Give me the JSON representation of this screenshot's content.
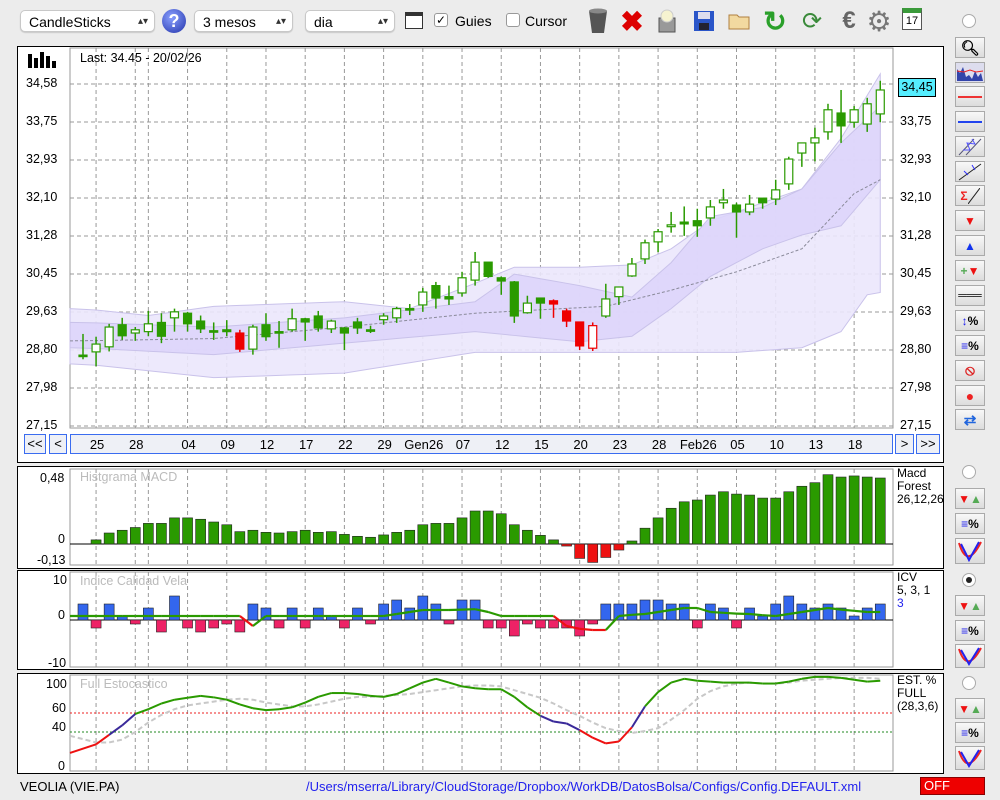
{
  "toolbar": {
    "chart_type": "CandleSticks",
    "period": "3 mesos",
    "interval": "dia",
    "guides_label": "Guies",
    "guides_checked": true,
    "cursor_label": "Cursor",
    "cursor_checked": false,
    "icons": [
      "trash-icon",
      "delete-icon",
      "lamp-icon",
      "save-icon",
      "open-folder-icon",
      "refresh-icon",
      "sync-icon",
      "euro-icon",
      "gear-icon",
      "calendar-icon"
    ],
    "calendar_day": "17"
  },
  "main": {
    "last_label": "Last: 34.45 - 20/02/26",
    "current_price": "34,45",
    "price_ticks": [
      "34,58",
      "33,75",
      "32,93",
      "32,10",
      "31,28",
      "30,45",
      "29,63",
      "28,80",
      "27,98",
      "27,15"
    ],
    "nav": {
      "first": "<<",
      "prev": "<",
      "next": ">",
      "last": ">>"
    },
    "date_labels": [
      {
        "label": "25",
        "i": 1
      },
      {
        "label": "28",
        "i": 4
      },
      {
        "label": "04",
        "i": 8
      },
      {
        "label": "09",
        "i": 11
      },
      {
        "label": "12",
        "i": 14
      },
      {
        "label": "17",
        "i": 17
      },
      {
        "label": "22",
        "i": 20
      },
      {
        "label": "29",
        "i": 23
      },
      {
        "label": "Gen26",
        "i": 26
      },
      {
        "label": "07",
        "i": 29
      },
      {
        "label": "12",
        "i": 32
      },
      {
        "label": "15",
        "i": 35
      },
      {
        "label": "20",
        "i": 38
      },
      {
        "label": "23",
        "i": 41
      },
      {
        "label": "28",
        "i": 44
      },
      {
        "label": "Feb26",
        "i": 47
      },
      {
        "label": "05",
        "i": 50
      },
      {
        "label": "10",
        "i": 53
      },
      {
        "label": "13",
        "i": 56
      },
      {
        "label": "18",
        "i": 59
      }
    ]
  },
  "macd_panel": {
    "title": "Histgrama MACD",
    "legend": [
      "Macd",
      "Forest",
      "26,12,26"
    ],
    "ticks": [
      "0,48",
      "0",
      "-0,13"
    ]
  },
  "icv_panel": {
    "title": "Indice Calidad Vela",
    "legend": [
      "ICV",
      "5, 3, 1"
    ],
    "legend_value": "3",
    "ticks": [
      "10",
      "0",
      "-10"
    ]
  },
  "stoch_panel": {
    "title": "Full Estocastico",
    "legend": [
      "EST. %",
      "FULL",
      "(28,3,6)"
    ],
    "ticks": [
      "100",
      "60",
      "40",
      "0"
    ]
  },
  "footer": {
    "symbol": "VEOLIA (VIE.PA)",
    "config_path": "/Users/mserra/Library/CloudStorage/Dropbox/WorkDB/DatosBolsa/Configs/Config.DEFAULT.xml",
    "status": "OFF"
  },
  "colors": {
    "up": "#2a9a00",
    "down_red": "#ee0000",
    "band_outer": "#ebe7fc",
    "band_inner": "#ddd5fb",
    "macd_pos": "#2a9a00",
    "macd_neg": "#ee1111",
    "icv_pos": "#3366ee",
    "icv_neg": "#ee2266",
    "stoch_hi": "#2a9a00",
    "stoch_mid": "#3a2a9a",
    "stoch_lo": "#ee1111",
    "accent_cyan": "#55eeff",
    "status_red": "#ee0000",
    "path_blue": "#2222ee"
  },
  "chart_data": {
    "type": "candlestick",
    "y_range": [
      27.15,
      34.58
    ],
    "candles_ohlc": [
      [
        28.69,
        29.15,
        28.6,
        28.69
      ],
      [
        28.76,
        29.09,
        28.45,
        28.93
      ],
      [
        28.87,
        29.37,
        28.77,
        29.3
      ],
      [
        29.35,
        29.5,
        29.02,
        29.11
      ],
      [
        29.17,
        29.3,
        29.0,
        29.24
      ],
      [
        29.2,
        29.65,
        29.1,
        29.37
      ],
      [
        29.4,
        29.6,
        28.95,
        29.1
      ],
      [
        29.5,
        29.7,
        29.2,
        29.63
      ],
      [
        29.6,
        29.63,
        29.2,
        29.37
      ],
      [
        29.43,
        29.55,
        29.17,
        29.26
      ],
      [
        29.22,
        29.4,
        29.02,
        29.22
      ],
      [
        29.24,
        29.45,
        29.1,
        29.2
      ],
      [
        29.17,
        29.24,
        28.76,
        28.82
      ],
      [
        28.82,
        29.35,
        28.7,
        29.3
      ],
      [
        29.35,
        29.6,
        29.0,
        29.09
      ],
      [
        29.2,
        29.43,
        28.85,
        29.2
      ],
      [
        29.24,
        29.7,
        29.2,
        29.48
      ],
      [
        29.48,
        29.5,
        29.0,
        29.41
      ],
      [
        29.54,
        29.65,
        29.2,
        29.28
      ],
      [
        29.26,
        29.46,
        29.17,
        29.43
      ],
      [
        29.28,
        29.3,
        28.8,
        29.17
      ],
      [
        29.41,
        29.5,
        29.15,
        29.28
      ],
      [
        29.24,
        29.33,
        29.17,
        29.24
      ],
      [
        29.46,
        29.6,
        29.35,
        29.54
      ],
      [
        29.5,
        29.74,
        29.39,
        29.7
      ],
      [
        29.7,
        29.8,
        29.56,
        29.7
      ],
      [
        29.78,
        30.15,
        29.63,
        30.06
      ],
      [
        30.2,
        30.28,
        29.7,
        29.93
      ],
      [
        29.96,
        30.2,
        29.78,
        29.91
      ],
      [
        30.04,
        30.5,
        29.96,
        30.37
      ],
      [
        30.32,
        30.93,
        30.2,
        30.71
      ],
      [
        30.71,
        30.71,
        30.37,
        30.4
      ],
      [
        30.37,
        30.4,
        30.0,
        30.3
      ],
      [
        30.28,
        30.3,
        29.39,
        29.54
      ],
      [
        29.61,
        29.98,
        29.59,
        29.82
      ],
      [
        29.93,
        29.93,
        29.48,
        29.82
      ],
      [
        29.87,
        29.9,
        29.5,
        29.8
      ],
      [
        29.65,
        29.7,
        29.3,
        29.43
      ],
      [
        29.41,
        29.41,
        28.8,
        28.89
      ],
      [
        28.84,
        29.4,
        28.78,
        29.33
      ],
      [
        29.54,
        30.24,
        29.5,
        29.91
      ],
      [
        29.96,
        30.17,
        29.78,
        30.17
      ],
      [
        30.41,
        30.8,
        30.39,
        30.67
      ],
      [
        30.78,
        31.2,
        30.67,
        31.13
      ],
      [
        31.15,
        31.43,
        30.93,
        31.37
      ],
      [
        31.48,
        31.8,
        31.35,
        31.52
      ],
      [
        31.58,
        31.92,
        31.28,
        31.54
      ],
      [
        31.61,
        31.87,
        31.26,
        31.5
      ],
      [
        31.67,
        32.06,
        31.5,
        31.91
      ],
      [
        32.0,
        32.3,
        31.87,
        32.06
      ],
      [
        31.95,
        32.0,
        31.24,
        31.8
      ],
      [
        31.8,
        32.17,
        31.73,
        31.97
      ],
      [
        32.1,
        32.1,
        31.87,
        32.0
      ],
      [
        32.08,
        32.5,
        31.95,
        32.28
      ],
      [
        32.41,
        33.0,
        32.28,
        32.95
      ],
      [
        33.08,
        33.3,
        32.78,
        33.3
      ],
      [
        33.3,
        33.63,
        32.9,
        33.41
      ],
      [
        33.54,
        34.15,
        33.37,
        34.02
      ],
      [
        33.95,
        34.45,
        33.3,
        33.67
      ],
      [
        33.75,
        34.1,
        33.63,
        34.02
      ],
      [
        33.71,
        34.28,
        33.54,
        34.15
      ],
      [
        33.93,
        34.65,
        33.75,
        34.45
      ]
    ],
    "red_candles": [
      12,
      36,
      37,
      38,
      39
    ],
    "bands": {
      "outer_upper": [
        [
          0,
          29.7
        ],
        [
          5,
          29.55
        ],
        [
          10,
          29.75
        ],
        [
          20,
          29.85
        ],
        [
          25,
          29.7
        ],
        [
          30,
          30.25
        ],
        [
          33,
          30.6
        ],
        [
          38,
          30.6
        ],
        [
          42,
          30.65
        ],
        [
          45,
          31.0
        ],
        [
          48,
          31.6
        ],
        [
          52,
          32.0
        ],
        [
          55,
          32.3
        ],
        [
          58,
          33.4
        ],
        [
          61,
          34.8
        ]
      ],
      "inner_upper": [
        [
          0,
          29.4
        ],
        [
          10,
          29.3
        ],
        [
          20,
          29.5
        ],
        [
          30,
          29.85
        ],
        [
          33,
          30.45
        ],
        [
          38,
          30.2
        ],
        [
          42,
          29.95
        ],
        [
          45,
          30.7
        ],
        [
          48,
          31.7
        ],
        [
          52,
          31.9
        ],
        [
          55,
          32.3
        ],
        [
          58,
          33.3
        ],
        [
          61,
          34.1
        ]
      ],
      "inner_lower": [
        [
          0,
          28.85
        ],
        [
          10,
          28.7
        ],
        [
          20,
          28.95
        ],
        [
          30,
          29.2
        ],
        [
          38,
          28.98
        ],
        [
          42,
          29.1
        ],
        [
          45,
          29.7
        ],
        [
          48,
          30.4
        ],
        [
          52,
          31.0
        ],
        [
          55,
          31.3
        ],
        [
          58,
          31.5
        ],
        [
          61,
          32.5
        ]
      ],
      "outer_lower": [
        [
          0,
          28.5
        ],
        [
          10,
          28.2
        ],
        [
          20,
          28.3
        ],
        [
          30,
          28.75
        ],
        [
          40,
          28.75
        ],
        [
          50,
          28.75
        ],
        [
          55,
          28.85
        ],
        [
          58,
          29.2
        ],
        [
          60,
          30.0
        ],
        [
          61,
          30.05
        ]
      ],
      "middle": [
        [
          0,
          29.0
        ],
        [
          10,
          29.05
        ],
        [
          20,
          29.3
        ],
        [
          30,
          29.6
        ],
        [
          40,
          29.75
        ],
        [
          45,
          30.1
        ],
        [
          50,
          30.5
        ],
        [
          55,
          31.0
        ],
        [
          59,
          32.2
        ],
        [
          61,
          32.5
        ]
      ]
    },
    "macd_hist": [
      0,
      0.03,
      0.08,
      0.1,
      0.12,
      0.15,
      0.15,
      0.19,
      0.19,
      0.18,
      0.16,
      0.14,
      0.09,
      0.1,
      0.085,
      0.08,
      0.09,
      0.1,
      0.085,
      0.09,
      0.07,
      0.056,
      0.049,
      0.066,
      0.085,
      0.1,
      0.14,
      0.15,
      0.15,
      0.19,
      0.24,
      0.24,
      0.22,
      0.14,
      0.1,
      0.063,
      0.03,
      -0.015,
      -0.105,
      -0.134,
      -0.098,
      -0.044,
      0.022,
      0.115,
      0.19,
      0.26,
      0.307,
      0.32,
      0.356,
      0.38,
      0.363,
      0.356,
      0.334,
      0.334,
      0.38,
      0.42,
      0.446,
      0.504,
      0.487,
      0.495,
      0.487,
      0.48
    ],
    "macd_range": [
      -0.13,
      0.48
    ],
    "icv_bars": [
      4,
      -2,
      4,
      1,
      -1,
      3,
      -3,
      6,
      -2,
      -3,
      -2,
      -1,
      -3,
      4,
      3,
      -2,
      3,
      -2,
      3,
      1,
      -2,
      3,
      -1,
      4,
      5,
      3,
      6,
      4,
      -1,
      5,
      5,
      -2,
      -2,
      -4,
      -1,
      -2,
      -2,
      -2,
      -4,
      -1,
      4,
      4,
      4,
      5,
      5,
      4,
      4,
      -2,
      4,
      3,
      -2,
      3,
      1,
      4,
      6,
      4,
      3,
      4,
      3,
      1,
      3,
      4
    ],
    "icv_line": [
      1,
      1,
      1,
      1,
      1,
      1,
      1,
      1,
      1,
      1,
      1,
      1,
      1,
      -1.5,
      1,
      1,
      1,
      1,
      1,
      1,
      1,
      1,
      1,
      1,
      1.5,
      2,
      2.5,
      2.5,
      2.5,
      2.6,
      2.7,
      2,
      1,
      1,
      1,
      1,
      1,
      -1.5,
      -2.2,
      -2.5,
      -2.5,
      1,
      1.3,
      1.5,
      2,
      2.5,
      3,
      3,
      2,
      1.8,
      1.6,
      1.5,
      1.2,
      1,
      1.5,
      2,
      2.5,
      3,
      2.6,
      2.3,
      2,
      2
    ],
    "icv_red_segments": [
      [
        12,
        13
      ],
      [
        36,
        40
      ]
    ],
    "icv_range": [
      -10,
      10
    ],
    "stoch_k": [
      18,
      27,
      37,
      47,
      59,
      64,
      70,
      74,
      76,
      78,
      76.5,
      74,
      69,
      65,
      63,
      64,
      66,
      71,
      77,
      81,
      81,
      80,
      78,
      77,
      80,
      86,
      92,
      96,
      92,
      88,
      86,
      85,
      85,
      77,
      66,
      57,
      51,
      49,
      42,
      34,
      28,
      30,
      45,
      67,
      82,
      92,
      96,
      94,
      93,
      92,
      92,
      92,
      91,
      91,
      93,
      96,
      98,
      98,
      97,
      95,
      93,
      94
    ],
    "stoch_d": [
      36,
      29,
      29,
      32,
      40,
      50,
      58,
      64,
      68,
      70,
      72,
      74,
      75,
      74,
      71,
      69,
      67,
      67,
      69,
      72,
      75,
      77,
      77,
      78,
      79,
      80,
      82,
      84,
      86,
      88,
      89,
      89,
      88,
      84,
      80,
      76,
      70,
      63,
      57,
      50,
      44,
      41,
      39,
      41,
      44,
      53,
      63,
      75,
      83,
      88,
      91,
      92,
      91,
      91,
      92,
      94,
      95,
      96,
      97,
      97,
      97,
      96
    ],
    "stoch_levels": [
      60,
      40
    ],
    "stoch_range": [
      0,
      100
    ],
    "grid": true
  }
}
